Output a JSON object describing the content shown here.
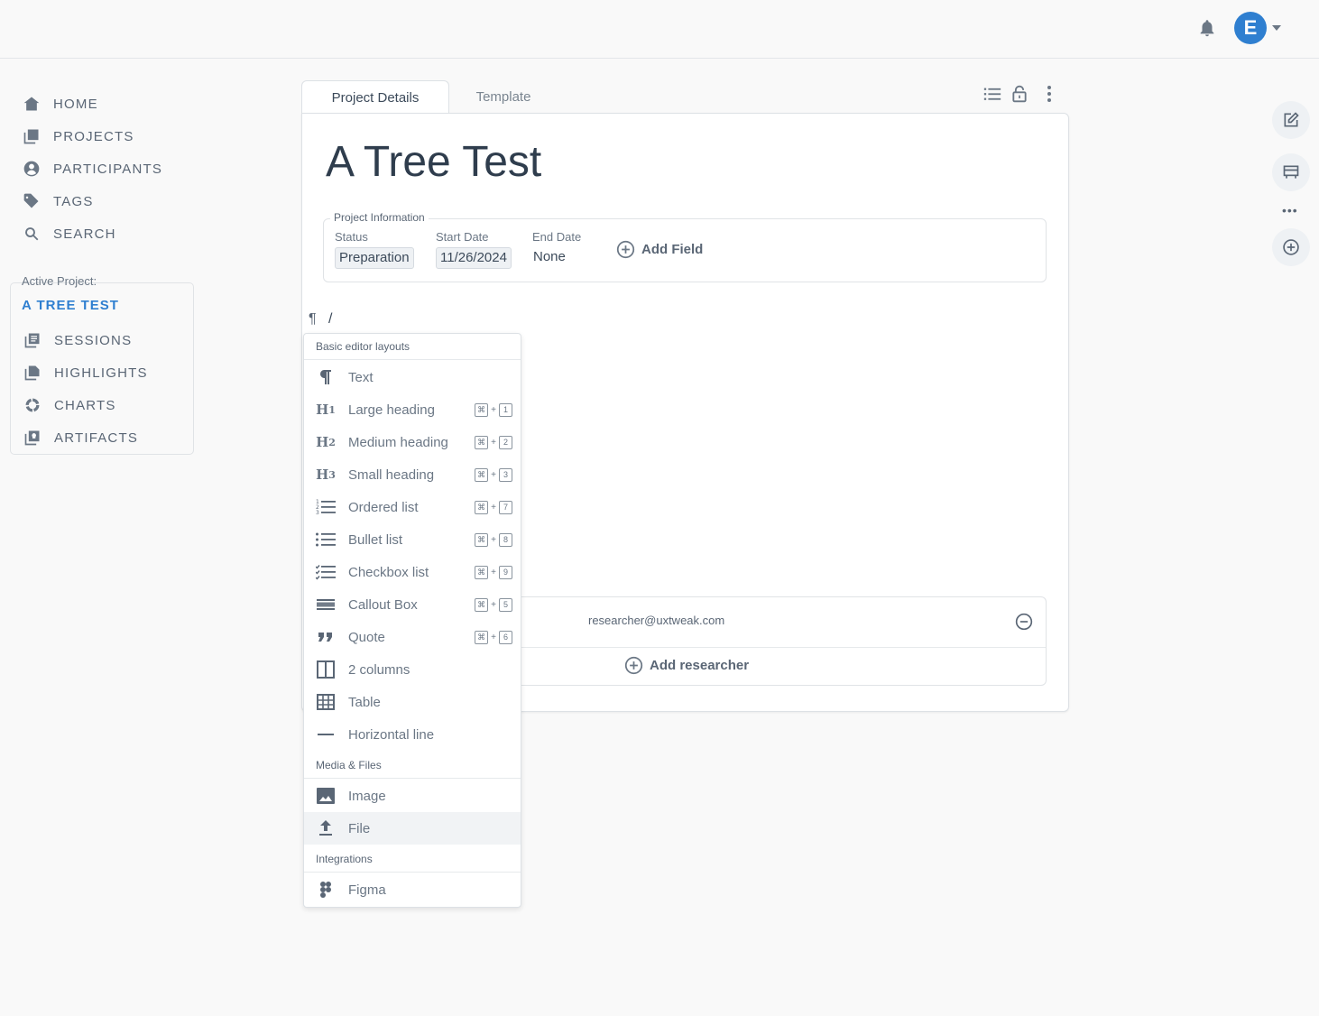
{
  "nav": {
    "items": [
      {
        "label": "HOME",
        "icon": "home-icon"
      },
      {
        "label": "PROJECTS",
        "icon": "projects-icon"
      },
      {
        "label": "PARTICIPANTS",
        "icon": "participants-icon"
      },
      {
        "label": "TAGS",
        "icon": "tags-icon"
      },
      {
        "label": "SEARCH",
        "icon": "search-icon"
      }
    ],
    "active_project_label": "Active Project:",
    "active_project_name": "A TREE TEST",
    "project_items": [
      {
        "label": "SESSIONS",
        "icon": "sessions-icon"
      },
      {
        "label": "HIGHLIGHTS",
        "icon": "highlights-icon"
      },
      {
        "label": "CHARTS",
        "icon": "charts-icon"
      },
      {
        "label": "ARTIFACTS",
        "icon": "artifacts-icon"
      }
    ]
  },
  "header": {
    "avatar_initial": "E"
  },
  "tabs": [
    {
      "label": "Project Details",
      "active": true
    },
    {
      "label": "Template",
      "active": false
    }
  ],
  "page": {
    "title": "A Tree Test",
    "project_info": {
      "legend": "Project Information",
      "fields": [
        {
          "label": "Status",
          "value": "Preparation"
        },
        {
          "label": "Start Date",
          "value": "11/26/2024"
        },
        {
          "label": "End Date",
          "value": "None"
        }
      ],
      "add_field_label": "Add Field"
    },
    "editor": {
      "paragraph_mark": "¶",
      "input": "/"
    },
    "researchers": {
      "email": "researcher@uxtweak.com",
      "add_label": "Add researcher"
    }
  },
  "menu": {
    "sections": {
      "basic": "Basic editor layouts",
      "media": "Media & Files",
      "integrations": "Integrations"
    },
    "items": [
      {
        "label": "Text",
        "icon": "paragraph-icon",
        "shortcut": ""
      },
      {
        "label": "Large heading",
        "icon": "heading-1-icon",
        "shortcut": "1"
      },
      {
        "label": "Medium heading",
        "icon": "heading-2-icon",
        "shortcut": "2"
      },
      {
        "label": "Small heading",
        "icon": "heading-3-icon",
        "shortcut": "3"
      },
      {
        "label": "Ordered list",
        "icon": "ordered-list-icon",
        "shortcut": "7"
      },
      {
        "label": "Bullet list",
        "icon": "bullet-list-icon",
        "shortcut": "8"
      },
      {
        "label": "Checkbox list",
        "icon": "checkbox-list-icon",
        "shortcut": "9"
      },
      {
        "label": "Callout Box",
        "icon": "callout-icon",
        "shortcut": "5"
      },
      {
        "label": "Quote",
        "icon": "quote-icon",
        "shortcut": "6"
      },
      {
        "label": "2 columns",
        "icon": "columns-icon",
        "shortcut": ""
      },
      {
        "label": "Table",
        "icon": "table-icon",
        "shortcut": ""
      },
      {
        "label": "Horizontal line",
        "icon": "horizontal-line-icon",
        "shortcut": ""
      },
      {
        "label": "Image",
        "icon": "image-icon",
        "shortcut": ""
      },
      {
        "label": "File",
        "icon": "upload-icon",
        "shortcut": ""
      },
      {
        "label": "Figma",
        "icon": "figma-icon",
        "shortcut": ""
      }
    ],
    "shortcut_modifier": "⌘",
    "shortcut_plus": "+"
  },
  "colors": {
    "accent": "#2f7fd0",
    "text": "#3c4a5a",
    "muted": "#6b7785"
  }
}
